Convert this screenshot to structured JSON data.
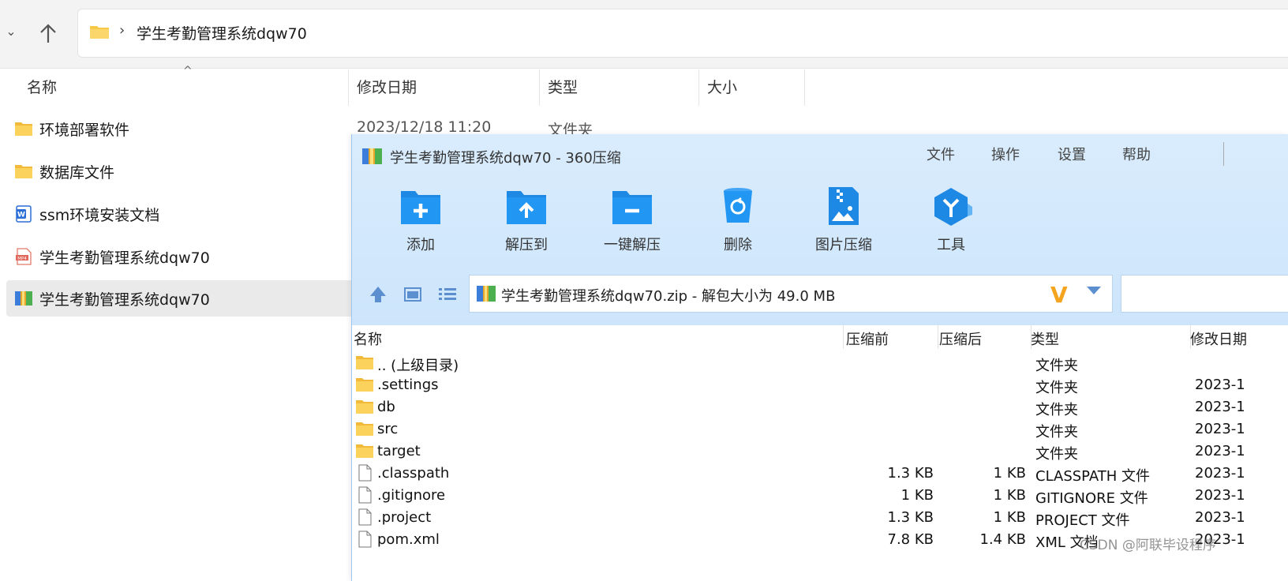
{
  "explorer": {
    "address": {
      "path": "学生考勤管理系统dqw70"
    },
    "columns": {
      "name": "名称",
      "date": "修改日期",
      "type": "类型",
      "size": "大小"
    },
    "rows": [
      {
        "name": "环境部署软件",
        "date": "2023/12/18 11:20",
        "type": "文件夹",
        "icon": "folder-icon"
      },
      {
        "name": "数据库文件",
        "date": "",
        "type": "",
        "icon": "folder-icon"
      },
      {
        "name": "ssm环境安装文档",
        "date": "",
        "type": "",
        "icon": "word-document-icon"
      },
      {
        "name": "学生考勤管理系统dqw70",
        "date": "",
        "type": "",
        "icon": "mp4-video-icon"
      },
      {
        "name": "学生考勤管理系统dqw70",
        "date": "",
        "type": "",
        "icon": "zip-archive-icon"
      }
    ]
  },
  "zip": {
    "title": "学生考勤管理系统dqw70 - 360压缩",
    "menu": [
      "文件",
      "操作",
      "设置",
      "帮助"
    ],
    "tools": [
      {
        "label": "添加",
        "icon": "add-folder-icon"
      },
      {
        "label": "解压到",
        "icon": "extract-to-folder-icon"
      },
      {
        "label": "一键解压",
        "icon": "one-click-extract-icon"
      },
      {
        "label": "删除",
        "icon": "recycle-bin-icon"
      },
      {
        "label": "图片压缩",
        "icon": "image-compress-icon"
      },
      {
        "label": "工具",
        "icon": "tools-cube-icon"
      }
    ],
    "path_text": "学生考勤管理系统dqw70.zip - 解包大小为 49.0 MB",
    "path_badge": "V",
    "columns": {
      "name": "名称",
      "before": "压缩前",
      "after": "压缩后",
      "type": "类型",
      "date": "修改日期"
    },
    "rows": [
      {
        "name": ".. (上级目录)",
        "before": "",
        "after": "",
        "type": "文件夹",
        "date": "",
        "icon": "folder-icon"
      },
      {
        "name": ".settings",
        "before": "",
        "after": "",
        "type": "文件夹",
        "date": "2023-1",
        "icon": "folder-icon"
      },
      {
        "name": "db",
        "before": "",
        "after": "",
        "type": "文件夹",
        "date": "2023-1",
        "icon": "folder-icon"
      },
      {
        "name": "src",
        "before": "",
        "after": "",
        "type": "文件夹",
        "date": "2023-1",
        "icon": "folder-icon"
      },
      {
        "name": "target",
        "before": "",
        "after": "",
        "type": "文件夹",
        "date": "2023-1",
        "icon": "folder-icon"
      },
      {
        "name": ".classpath",
        "before": "1.3 KB",
        "after": "1 KB",
        "type": "CLASSPATH 文件",
        "date": "2023-1",
        "icon": "file-icon"
      },
      {
        "name": ".gitignore",
        "before": "1 KB",
        "after": "1 KB",
        "type": "GITIGNORE 文件",
        "date": "2023-1",
        "icon": "file-icon"
      },
      {
        "name": ".project",
        "before": "1.3 KB",
        "after": "1 KB",
        "type": "PROJECT 文件",
        "date": "2023-1",
        "icon": "file-icon"
      },
      {
        "name": "pom.xml",
        "before": "7.8 KB",
        "after": "1.4 KB",
        "type": "XML 文档",
        "date": "2023-1",
        "icon": "file-icon"
      }
    ]
  },
  "watermark": "CSDN @阿联毕设程序",
  "colors": {
    "folder": "#f7c948",
    "zip_bg": "#d4e9fc",
    "accent_blue": "#1e88e5",
    "badge": "#f4a41f"
  }
}
